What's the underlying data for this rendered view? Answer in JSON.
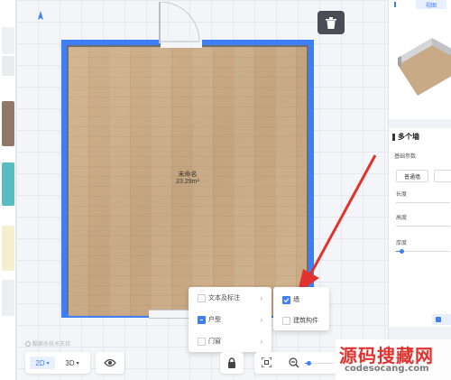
{
  "room": {
    "name": "未命名",
    "area": "23.29m²"
  },
  "context_menu": {
    "items": [
      {
        "label": "文本及标注",
        "state": "unchecked"
      },
      {
        "label": "户型",
        "state": "partial"
      },
      {
        "label": "门窗",
        "state": "unchecked"
      }
    ],
    "submenu": [
      {
        "label": "墙",
        "state": "checked"
      },
      {
        "label": "建筑构件",
        "state": "unchecked"
      }
    ]
  },
  "right_panel": {
    "view_tab": "视图",
    "section_title": "多个墙",
    "basic_params": "基础参数",
    "wall_type_button": "普通墙",
    "fields": [
      "长度",
      "高度",
      "厚度"
    ]
  },
  "bottom_bar": {
    "mode_2d": "2D",
    "mode_3d": "3D",
    "tech_note": "酷家乐技术支持"
  },
  "watermark": {
    "line1": "源码搜藏网",
    "line2": "codesocang.com"
  },
  "colors": {
    "accent": "#3f7ff6",
    "wall_blue": "#3f7ff6",
    "arrow_red": "#e2322d"
  }
}
